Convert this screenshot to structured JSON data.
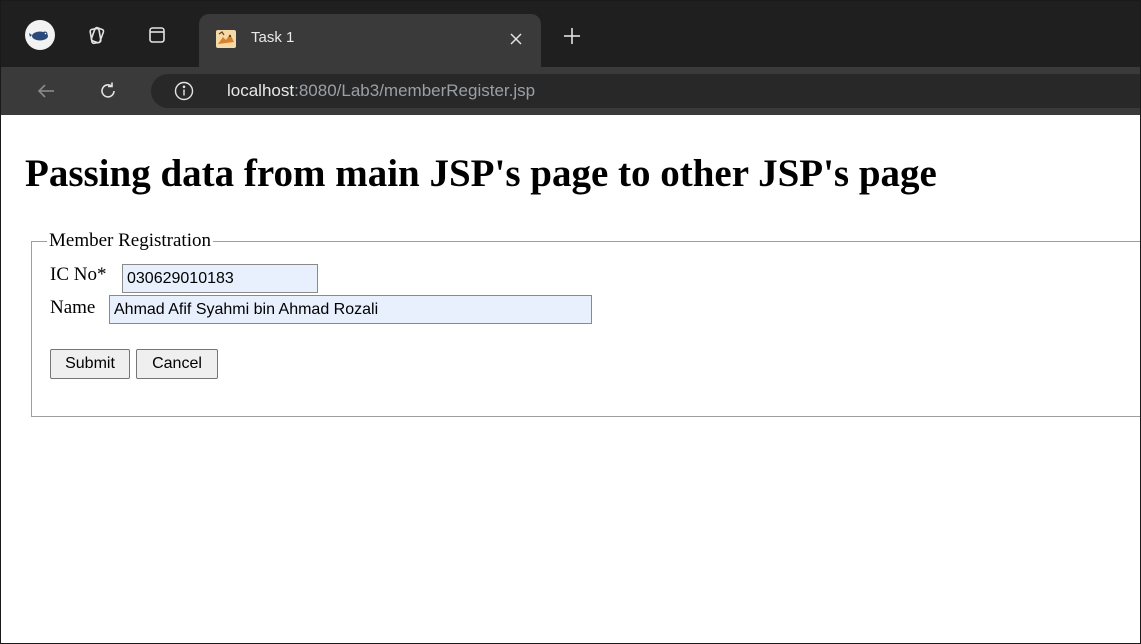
{
  "browser": {
    "tab": {
      "title": "Task 1",
      "favicon": "tomcat-favicon"
    },
    "toolbar": {
      "url_host": "localhost",
      "url_path": ":8080/Lab3/memberRegister.jsp"
    },
    "icons": {
      "profile": "profile-avatar-icon",
      "workspaces": "workspaces-icon",
      "tab_actions": "tab-actions-icon",
      "close_tab": "close-icon",
      "new_tab": "plus-icon",
      "back": "back-arrow-icon",
      "reload": "reload-icon",
      "site_info": "info-icon"
    },
    "colors": {
      "tabstrip": "#1f1f1f",
      "active_tab": "#3a3a3a",
      "omnibox": "#282828",
      "autofill_input": "#e8f0fe"
    }
  },
  "page": {
    "title": "Passing data from main JSP's page to other JSP's page",
    "form": {
      "legend": "Member Registration",
      "ic_label": "IC No*",
      "ic_value": "030629010183",
      "name_label": "Name",
      "name_value": "Ahmad Afif Syahmi bin Ahmad Rozali",
      "submit_label": "Submit",
      "cancel_label": "Cancel"
    }
  }
}
